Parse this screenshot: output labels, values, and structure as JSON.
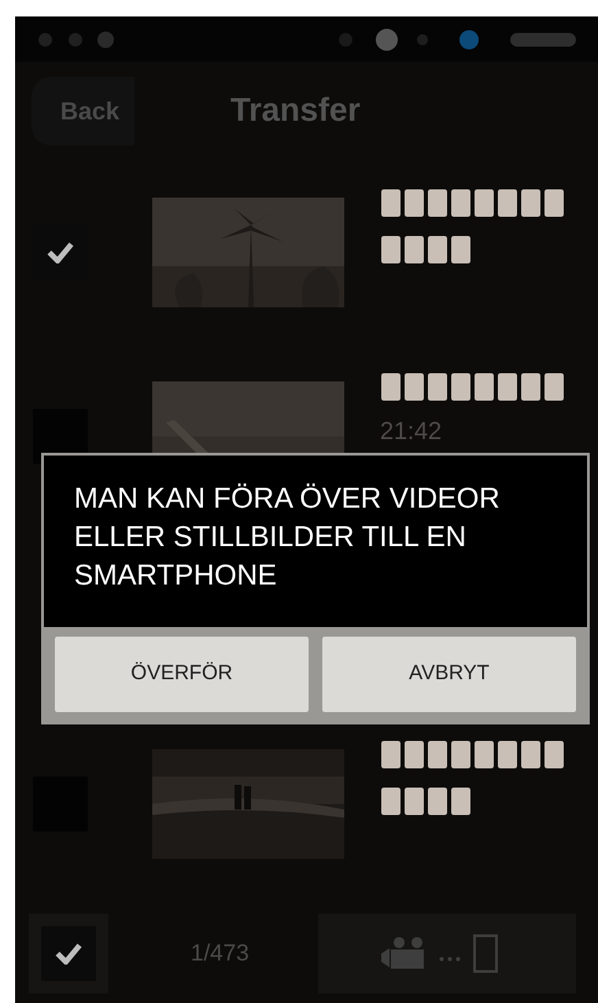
{
  "header": {
    "back": "Back",
    "title": "Transfer"
  },
  "rows": [
    {
      "checked": true
    },
    {
      "checked": false,
      "time": "21:42"
    },
    {
      "checked": false
    }
  ],
  "dialog": {
    "message": "MAN KAN FÖRA ÖVER VIDEOR ELLER STILLBILDER TILL EN SMARTPHONE",
    "buttons": [
      "ÖVERFÖR",
      "AVBRYT"
    ]
  },
  "footer": {
    "select_all_checked": true,
    "count": "1/473"
  }
}
